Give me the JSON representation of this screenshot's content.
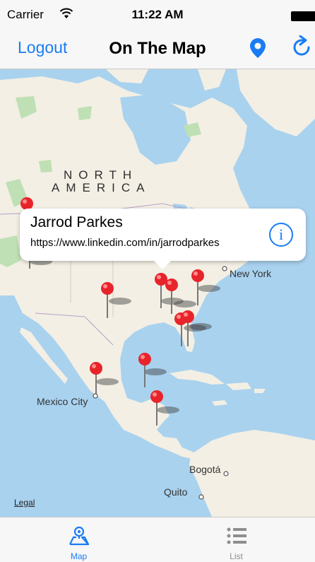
{
  "status_bar": {
    "carrier": "Carrier",
    "time": "11:22 AM",
    "wifi_icon": "wifi-icon",
    "battery_icon": "battery-icon"
  },
  "nav_bar": {
    "logout_label": "Logout",
    "title": "On The Map",
    "pin_icon": "map-pin-icon",
    "refresh_icon": "refresh-icon"
  },
  "map": {
    "labels": {
      "continent_line1": "NORTH",
      "continent_line2": "AMERICA",
      "new_york": "New York",
      "mexico_city": "Mexico City",
      "bogota": "Bogotá",
      "quito": "Quito",
      "legal": "Legal"
    },
    "callout": {
      "name": "Jarrod Parkes",
      "url": "https://www.linkedin.com/in/jarrodparkes",
      "info_icon": "i"
    },
    "colors": {
      "water": "#a9d2ef",
      "land": "#f3efe4",
      "park": "#bfe0b4",
      "pin": "#e8242b",
      "accent": "#1a7cf4"
    }
  },
  "tab_bar": {
    "tabs": [
      {
        "label": "Map",
        "icon": "map-tab-icon",
        "selected": true
      },
      {
        "label": "List",
        "icon": "list-tab-icon",
        "selected": false
      }
    ]
  }
}
